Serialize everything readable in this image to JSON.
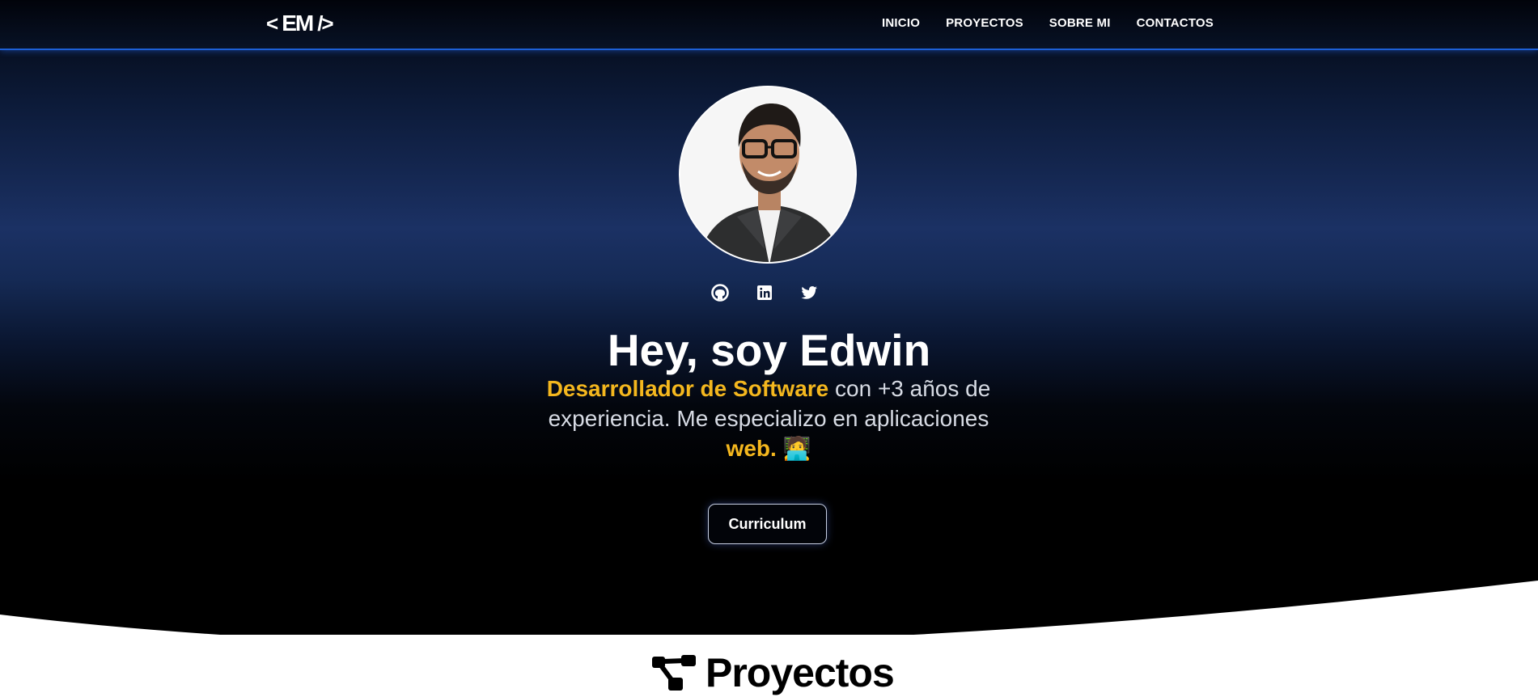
{
  "logo": {
    "lt": "<",
    "text": "EM",
    "gt": "/>"
  },
  "nav": {
    "items": [
      {
        "label": "INICIO"
      },
      {
        "label": "PROYECTOS"
      },
      {
        "label": "SOBRE MI"
      },
      {
        "label": "CONTACTOS"
      }
    ]
  },
  "hero": {
    "avatar_alt": "Edwin",
    "socials": [
      {
        "icon": "github-icon"
      },
      {
        "icon": "linkedin-icon"
      },
      {
        "icon": "twitter-icon"
      }
    ],
    "headline": "Hey, soy Edwin",
    "subtitle": {
      "highlight_role": "Desarrollador de Software",
      "part1": " con +3 años de experiencia. Me especializo en aplicaciones ",
      "highlight_web": "web.",
      "emoji": "🧑‍💻"
    },
    "cv_button": "Curriculum",
    "accent_color": "#f4b71e"
  },
  "projects": {
    "icon": "projects-icon",
    "title": "Proyectos"
  }
}
